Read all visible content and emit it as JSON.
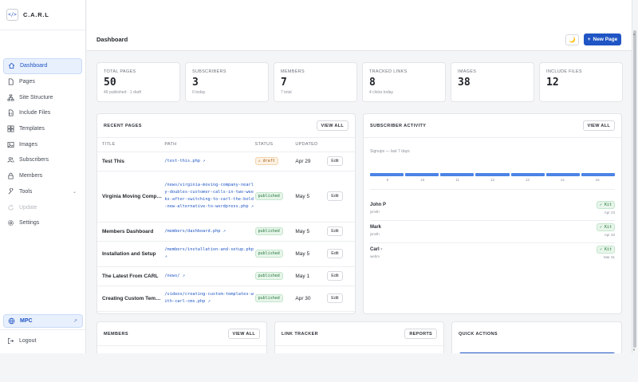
{
  "app": {
    "brand": "C.A.R.L",
    "brand_logo": "</>"
  },
  "sidebar": {
    "items": [
      {
        "label": "Dashboard",
        "icon": "home-icon",
        "active": true
      },
      {
        "label": "Pages",
        "icon": "file-icon"
      },
      {
        "label": "Site Structure",
        "icon": "sitemap-icon"
      },
      {
        "label": "Include Files",
        "icon": "code-icon"
      },
      {
        "label": "Templates",
        "icon": "layout-icon"
      },
      {
        "label": "Images",
        "icon": "image-icon"
      },
      {
        "label": "Subscribers",
        "icon": "users-icon"
      },
      {
        "label": "Members",
        "icon": "lock-icon"
      },
      {
        "label": "Tools",
        "icon": "wrench-icon"
      },
      {
        "label": "Update",
        "icon": "refresh-icon",
        "disabled": true
      },
      {
        "label": "Settings",
        "icon": "gear-icon"
      }
    ],
    "workspace": "MPC",
    "logout": "Logout"
  },
  "header": {
    "title": "Dashboard",
    "new_page_label": "New Page",
    "theme_icon": "moon-icon"
  },
  "stats": [
    {
      "label": "TOTAL PAGES",
      "value": "50",
      "sub": "49 published · 1 draft"
    },
    {
      "label": "SUBSCRIBERS",
      "value": "3",
      "sub": "0 today"
    },
    {
      "label": "MEMBERS",
      "value": "7",
      "sub": "7 total"
    },
    {
      "label": "TRACKED LINKS",
      "value": "8",
      "sub": "4 clicks today"
    },
    {
      "label": "IMAGES",
      "value": "38",
      "sub": ""
    },
    {
      "label": "INCLUDE FILES",
      "value": "12",
      "sub": ""
    }
  ],
  "recent_pages": {
    "title": "RECENT PAGES",
    "view_all": "VIEW ALL",
    "columns": [
      "TITLE",
      "PATH",
      "STATUS",
      "UPDATED",
      ""
    ],
    "edit_label": "Edit",
    "rows": [
      {
        "title": "Test This",
        "path": "/test-this.php ↗",
        "status": "⚠ draft",
        "status_type": "draft",
        "updated": "Apr 29"
      },
      {
        "title": "Virginia Moving Comp…",
        "path": "/news/virginia-moving-company-nearly-doubles-customer-calls-in-two-weeks-after-switching-to-carl-the-bold-new-alternative-to-wordpress.php ↗",
        "status": "published",
        "status_type": "published",
        "updated": "May 5"
      },
      {
        "title": "Members Dashboard",
        "path": "/members/dashboard.php ↗",
        "status": "published",
        "status_type": "published",
        "updated": "May 5"
      },
      {
        "title": "Installation and Setup",
        "path": "/members/installation-and-setup.php ↗",
        "status": "published",
        "status_type": "published",
        "updated": "May 5"
      },
      {
        "title": "The Latest From CARL",
        "path": "/news/ ↗",
        "status": "published",
        "status_type": "published",
        "updated": "May 1"
      },
      {
        "title": "Creating Custom Tem…",
        "path": "/videos/creating-custom-templates-with-carl-cms.php ↗",
        "status": "published",
        "status_type": "published",
        "updated": "Apr 30"
      }
    ]
  },
  "subscriber_activity": {
    "title": "SUBSCRIBER ACTIVITY",
    "view_all": "VIEW ALL",
    "caption": "Signups — last 7 days",
    "days": [
      "9",
      "10",
      "11",
      "12",
      "13",
      "14",
      "15"
    ],
    "subscribers": [
      {
        "name": "John P",
        "email": "jsmith",
        "tag": "✓ Kit",
        "date": "Apr 23"
      },
      {
        "name": "Mark",
        "email": "jsmith",
        "tag": "✓ Kit",
        "date": "Apr 20"
      },
      {
        "name": "Carl -",
        "email": "webm",
        "tag": "✓ Kit",
        "date": "Mar 31"
      }
    ]
  },
  "members": {
    "title": "MEMBERS",
    "view_all": "VIEW ALL"
  },
  "link_tracker": {
    "title": "LINK TRACKER",
    "reports": "REPORTS"
  },
  "quick_actions": {
    "title": "QUICK ACTIONS"
  },
  "colors": {
    "accent": "#1f55c4",
    "published": "#257a3c",
    "draft": "#a35e12"
  }
}
